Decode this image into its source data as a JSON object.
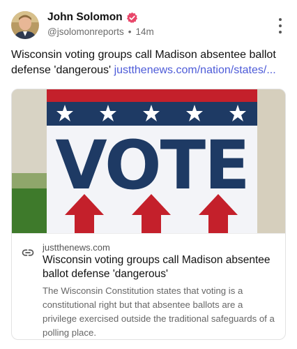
{
  "post": {
    "author_name": "John Solomon",
    "handle": "@jsolomonreports",
    "separator": "•",
    "time": "14m",
    "text": "Wisconsin voting groups call Madison absentee ballot defense 'dangerous' ",
    "link_text": "justthenews.com/nation/states/..."
  },
  "icons": {
    "verified": "verified-badge-icon",
    "more": "more-vertical-icon",
    "link": "link-icon"
  },
  "colors": {
    "verified": "#e8476a",
    "link": "#4d5bd8",
    "sign_red": "#c4202b",
    "sign_blue": "#1e3a64"
  },
  "card": {
    "image_text": "VOTE",
    "domain": "justthenews.com",
    "title": "Wisconsin voting groups call Madison absentee ballot defense 'dangerous'",
    "description": "The Wisconsin Constitution states that voting is a constitutional right but that absentee ballots are a privilege exercised outside the traditional safeguards of a polling place."
  }
}
